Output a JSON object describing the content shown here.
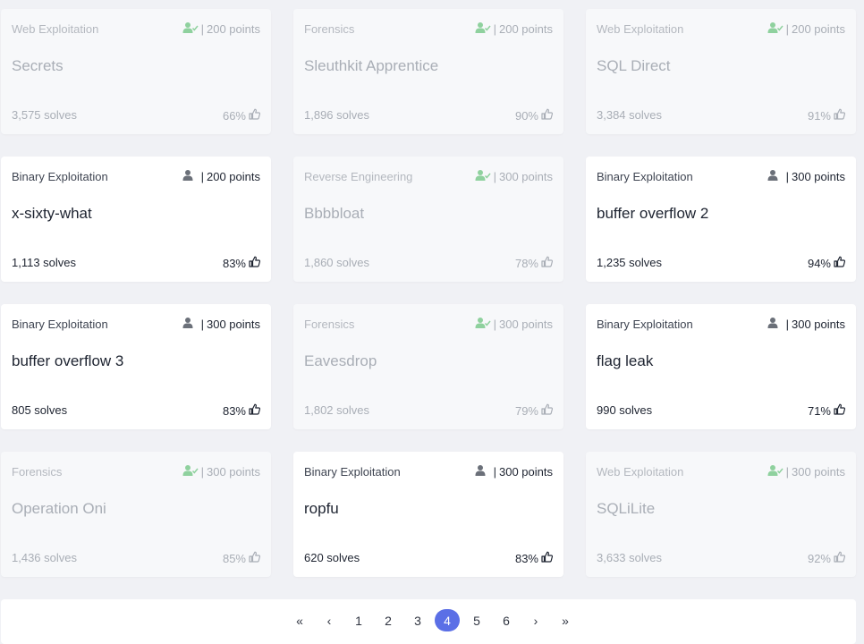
{
  "colors": {
    "accent": "#5b6fe6",
    "solved_icon": "#8fd19e",
    "page_bg": "#f0f1f5"
  },
  "challenges": [
    {
      "category": "Web Exploitation",
      "points": "200 points",
      "name": "Secrets",
      "solves": "3,575 solves",
      "rating": "66%",
      "solved": true
    },
    {
      "category": "Forensics",
      "points": "200 points",
      "name": "Sleuthkit Apprentice",
      "solves": "1,896 solves",
      "rating": "90%",
      "solved": true
    },
    {
      "category": "Web Exploitation",
      "points": "200 points",
      "name": "SQL Direct",
      "solves": "3,384 solves",
      "rating": "91%",
      "solved": true
    },
    {
      "category": "Binary Exploitation",
      "points": "200 points",
      "name": "x-sixty-what",
      "solves": "1,113 solves",
      "rating": "83%",
      "solved": false
    },
    {
      "category": "Reverse Engineering",
      "points": "300 points",
      "name": "Bbbbloat",
      "solves": "1,860 solves",
      "rating": "78%",
      "solved": true
    },
    {
      "category": "Binary Exploitation",
      "points": "300 points",
      "name": "buffer overflow 2",
      "solves": "1,235 solves",
      "rating": "94%",
      "solved": false
    },
    {
      "category": "Binary Exploitation",
      "points": "300 points",
      "name": "buffer overflow 3",
      "solves": "805 solves",
      "rating": "83%",
      "solved": false
    },
    {
      "category": "Forensics",
      "points": "300 points",
      "name": "Eavesdrop",
      "solves": "1,802 solves",
      "rating": "79%",
      "solved": true
    },
    {
      "category": "Binary Exploitation",
      "points": "300 points",
      "name": "flag leak",
      "solves": "990 solves",
      "rating": "71%",
      "solved": false
    },
    {
      "category": "Forensics",
      "points": "300 points",
      "name": "Operation Oni",
      "solves": "1,436 solves",
      "rating": "85%",
      "solved": true
    },
    {
      "category": "Binary Exploitation",
      "points": "300 points",
      "name": "ropfu",
      "solves": "620 solves",
      "rating": "83%",
      "solved": false
    },
    {
      "category": "Web Exploitation",
      "points": "300 points",
      "name": "SQLiLite",
      "solves": "3,633 solves",
      "rating": "92%",
      "solved": true
    }
  ],
  "card_icons": {
    "user_icon": "user-icon",
    "user_solved_icon": "user-check-icon",
    "separator": "|",
    "rating_icon": "thumbs-up-icon"
  },
  "pagination": {
    "first": "«",
    "prev": "‹",
    "pages": [
      "1",
      "2",
      "3",
      "4",
      "5",
      "6"
    ],
    "current": "4",
    "next": "›",
    "last": "»"
  }
}
